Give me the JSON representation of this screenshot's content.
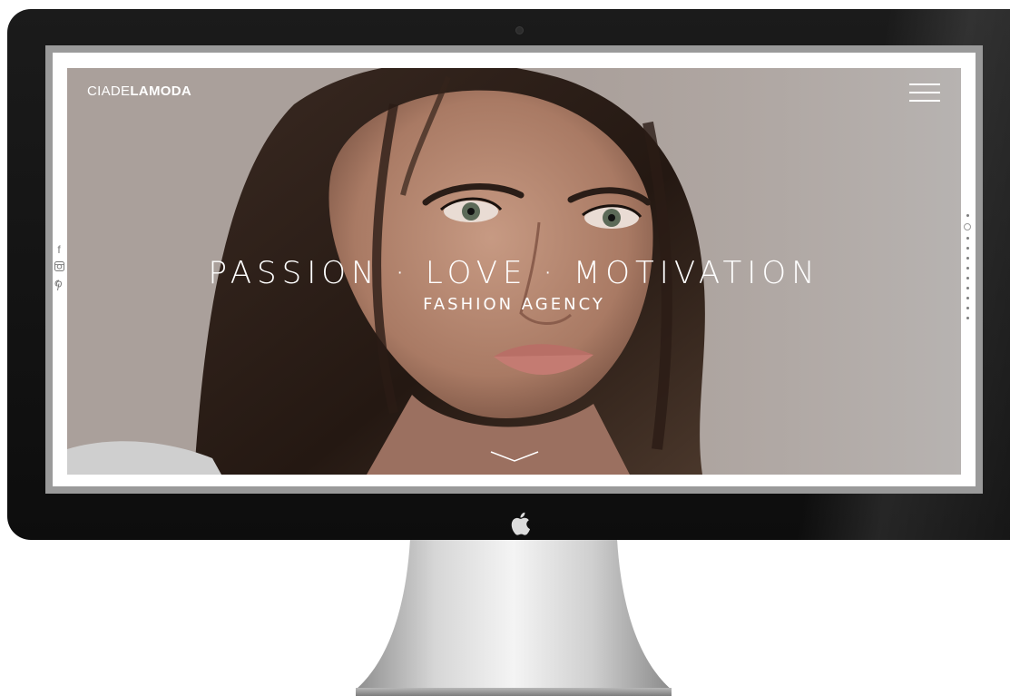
{
  "site": {
    "logo_light": "CIADE",
    "logo_bold": "LAMODA"
  },
  "hero": {
    "headline": "PASSION · LOVE · MOTIVATION",
    "subheadline": "FASHION AGENCY"
  },
  "social": [
    {
      "icon": "facebook-icon",
      "glyph": "f"
    },
    {
      "icon": "instagram-icon",
      "glyph": "◙"
    },
    {
      "icon": "pinterest-icon",
      "glyph": "℘"
    }
  ],
  "pagination": {
    "count": 11,
    "active_index": 1
  },
  "colors": {
    "bezel": "#111111",
    "text": "#ffffff",
    "accent_dot": "#7d7d7d"
  }
}
